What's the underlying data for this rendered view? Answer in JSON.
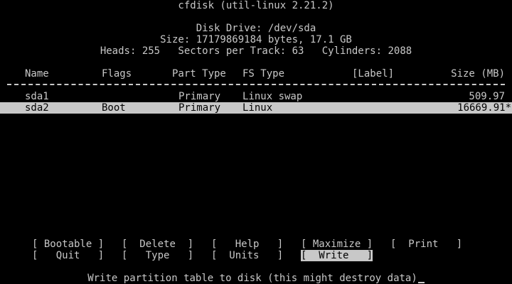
{
  "header": {
    "title": "cfdisk (util-linux 2.21.2)",
    "disk_drive_label": "Disk Drive:",
    "disk_drive_value": "/dev/sda",
    "size_label": "Size:",
    "size_value": "17179869184 bytes, 17.1 GB",
    "heads_label": "Heads:",
    "heads_value": "255",
    "sectors_label": "Sectors per Track:",
    "sectors_value": "63",
    "cylinders_label": "Cylinders:",
    "cylinders_value": "2088"
  },
  "table": {
    "columns": {
      "name": "Name",
      "flags": "Flags",
      "part_type": "Part Type",
      "fs_type": "FS Type",
      "label": "[Label]",
      "size": "Size (MB)"
    },
    "rows": [
      {
        "name": "sda1",
        "flags": "",
        "part_type": "Primary",
        "fs_type": "Linux swap",
        "label": "",
        "size": "509.97"
      },
      {
        "name": "sda2",
        "flags": "Boot",
        "part_type": "Primary",
        "fs_type": "Linux",
        "label": "",
        "size": "16669.91*"
      }
    ]
  },
  "menu": {
    "bootable": "Bootable",
    "delete": "Delete",
    "help": "Help",
    "maximize": "Maximize",
    "print": "Print",
    "quit": "Quit",
    "type": "Type",
    "units": "Units",
    "write": "Write"
  },
  "status": {
    "message": "Write partition table to disk (this might destroy data)"
  },
  "colors": {
    "background": "#000000",
    "foreground": "#c8c8c8",
    "highlight_bg": "#c8c8c8",
    "highlight_fg": "#000000"
  }
}
